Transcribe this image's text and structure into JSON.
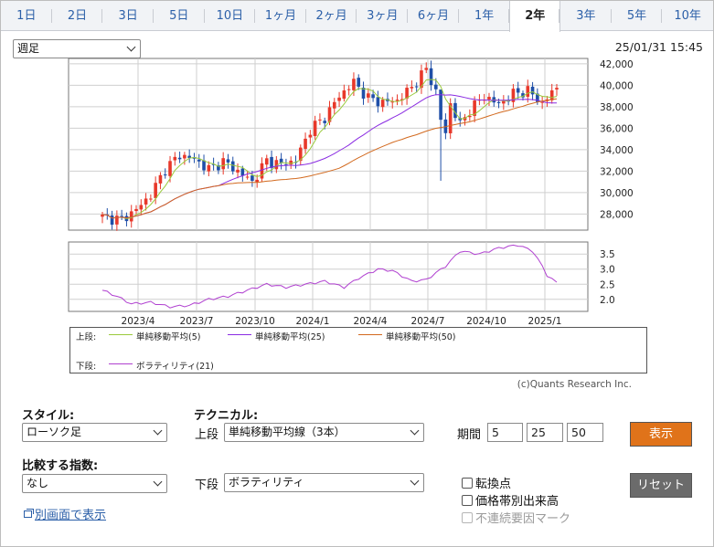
{
  "tabs": [
    "1日",
    "2日",
    "3日",
    "5日",
    "10日",
    "1ヶ月",
    "2ヶ月",
    "3ヶ月",
    "6ヶ月",
    "1年",
    "2年",
    "3年",
    "5年",
    "10年"
  ],
  "active_tab": "2年",
  "period_select": {
    "value": "週足"
  },
  "timestamp": "25/01/31 15:45",
  "chart_data": [
    {
      "type": "candlestick",
      "x_ticks": [
        "2023/4",
        "2023/7",
        "2023/10",
        "2024/1",
        "2024/4",
        "2024/7",
        "2024/10",
        "2025/1"
      ],
      "y_ticks": [
        "28,000",
        "30,000",
        "32,000",
        "34,000",
        "36,000",
        "38,000",
        "40,000",
        "42,000"
      ],
      "ylim": [
        26500,
        42500
      ],
      "grid": true,
      "series": [
        {
          "name": "単純移動平均(5)",
          "color": "#9aca3c"
        },
        {
          "name": "単純移動平均(25)",
          "color": "#8a2be2"
        },
        {
          "name": "単純移動平均(50)",
          "color": "#d2691e"
        }
      ]
    },
    {
      "type": "line",
      "y_ticks": [
        "2.0",
        "2.5",
        "3.0",
        "3.5"
      ],
      "ylim": [
        1.6,
        3.9
      ],
      "grid": true,
      "series": [
        {
          "name": "ボラティリティ(21)",
          "color": "#b040d0"
        }
      ]
    }
  ],
  "legend": {
    "upper_label": "上段:",
    "lower_label": "下段:",
    "items": [
      {
        "label": "単純移動平均(5)",
        "color": "#9aca3c"
      },
      {
        "label": "単純移動平均(25)",
        "color": "#8a2be2"
      },
      {
        "label": "単純移動平均(50)",
        "color": "#d2691e"
      },
      {
        "label": "ボラティリティ(21)",
        "color": "#b040d0"
      }
    ]
  },
  "credit": "(c)Quants Research Inc.",
  "controls": {
    "style_label": "スタイル:",
    "style_value": "ローソク足",
    "technical_label": "テクニカル:",
    "upper_label": "上段",
    "upper_value": "単純移動平均線（3本）",
    "period_label": "期間",
    "periods": [
      "5",
      "25",
      "50"
    ],
    "show_button": "表示",
    "compare_label": "比較する指数:",
    "compare_value": "なし",
    "lower_label": "下段",
    "lower_value": "ボラティリティ",
    "reset_button": "リセット",
    "checkboxes": [
      "転換点",
      "価格帯別出来高",
      "不連続要因マーク"
    ],
    "link": "別画面で表示"
  },
  "colors": {
    "up": "#e8382a",
    "down": "#1f4fa8",
    "accent_button": "#e0731a",
    "reset_button": "#6b6b6b",
    "link": "#2b5fa8"
  }
}
